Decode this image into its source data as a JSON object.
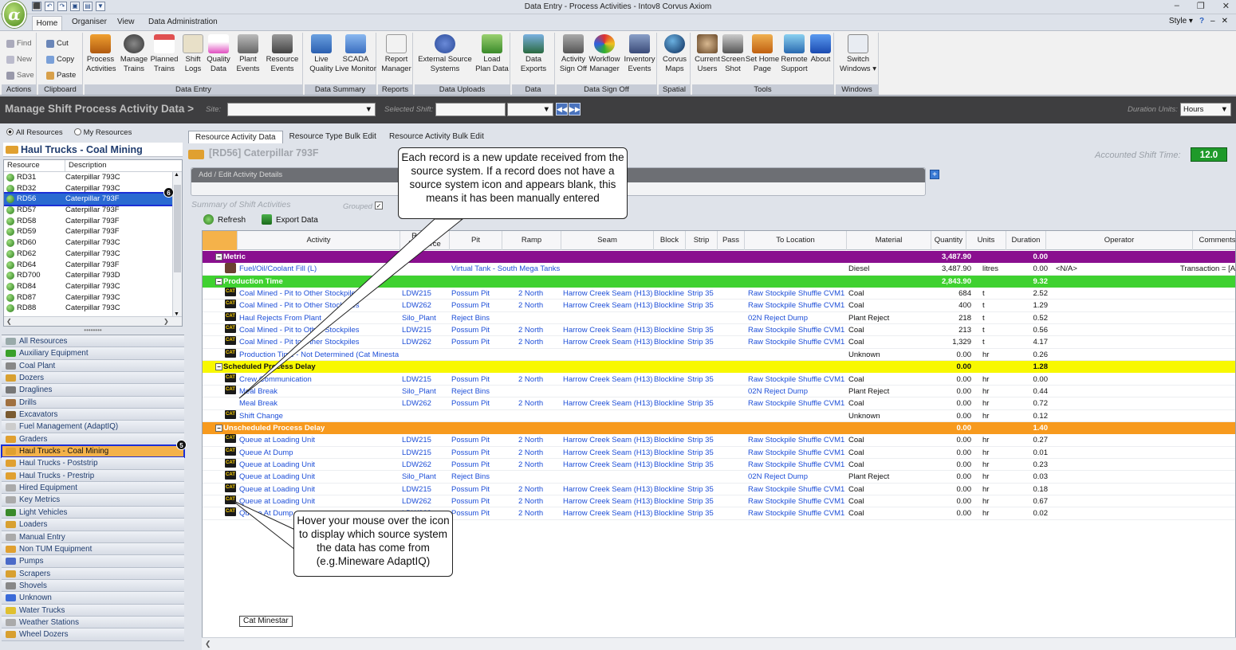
{
  "window": {
    "title": "Data Entry - Process Activities - Intov8 Corvus Axiom",
    "app_logo": "α",
    "controls": [
      "–",
      "❐",
      "✕"
    ],
    "qat_glyphs": [
      "⬛",
      "↶",
      "↷",
      "▣",
      "▤",
      "▼"
    ]
  },
  "ribbon_tabs": {
    "home": "Home",
    "organiser": "Organiser",
    "view": "View",
    "data_admin": "Data Administration"
  },
  "style_control": {
    "style": "Style ▾",
    "help": "?",
    "min": "–",
    "close": "✕"
  },
  "ribbon": {
    "actions": {
      "find": "Find",
      "new": "New",
      "save": "Save",
      "caption": "Actions"
    },
    "clipboard": {
      "cut": "Cut",
      "copy": "Copy",
      "paste": "Paste",
      "caption": "Clipboard"
    },
    "data_entry": {
      "process_activities": "Process\nActivities",
      "manage_trains": "Manage\nTrains",
      "planned_trains": "Planned\nTrains",
      "shift_logs": "Shift\nLogs",
      "quality_data": "Quality\nData",
      "plant_events": "Plant\nEvents",
      "resource_events": "Resource\nEvents",
      "caption": "Data Entry"
    },
    "data_summary": {
      "live_quality": "Live\nQuality",
      "scada": "SCADA\nLive Monitor",
      "caption": "Data Summary"
    },
    "reports": {
      "report_manager": "Report\nManager",
      "caption": "Reports"
    },
    "data_uploads": {
      "external_source": "External Source\nSystems",
      "load_plan": "Load\nPlan Data",
      "caption": "Data Uploads"
    },
    "data_exports": {
      "data_exports": "Data\nExports",
      "caption": "Data Exports"
    },
    "data_signoff": {
      "activity_signoff": "Activity\nSign Off",
      "workflow_manager": "Workflow\nManager",
      "inventory_events": "Inventory\nEvents",
      "caption": "Data Sign Off"
    },
    "spatial": {
      "corvus_maps": "Corvus\nMaps",
      "caption": "Spatial"
    },
    "tools": {
      "current_users": "Current\nUsers",
      "screen_shot": "Screen\nShot",
      "set_home": "Set Home\nPage",
      "remote_support": "Remote\nSupport",
      "about": "About",
      "caption": "Tools"
    },
    "windows": {
      "switch_windows": "Switch\nWindows ▾",
      "caption": "Windows"
    }
  },
  "header": {
    "title": "Manage Shift Process Activity Data  >",
    "site_label": "Site:",
    "site_value": "",
    "selected_shift_label": "Selected Shift:",
    "duration_units_label": "Duration Units:",
    "duration_units_value": "Hours",
    "dropdown_glyph": "▼",
    "nav_prev": "◀◀",
    "nav_next": "▶▶"
  },
  "left_panel": {
    "all_resources": "All Resources",
    "my_resources": "My Resources",
    "group_title": "Haul Trucks - Coal Mining",
    "col_resource": "Resource",
    "col_description": "Description",
    "scroll_up": "▲",
    "scroll_down": "▼",
    "scroll_left": "❮",
    "scroll_right": "❯",
    "splitter": "••••••••",
    "resources": [
      {
        "id": "RD31",
        "desc": "Caterpillar 793C"
      },
      {
        "id": "RD32",
        "desc": "Caterpillar 793C"
      },
      {
        "id": "RD56",
        "desc": "Caterpillar 793F"
      },
      {
        "id": "RD57",
        "desc": "Caterpillar 793F"
      },
      {
        "id": "RD58",
        "desc": "Caterpillar 793F"
      },
      {
        "id": "RD59",
        "desc": "Caterpillar 793F"
      },
      {
        "id": "RD60",
        "desc": "Caterpillar 793C"
      },
      {
        "id": "RD62",
        "desc": "Caterpillar 793C"
      },
      {
        "id": "RD64",
        "desc": "Caterpillar 793F"
      },
      {
        "id": "RD700",
        "desc": "Caterpillar 793D"
      },
      {
        "id": "RD84",
        "desc": "Caterpillar 793C"
      },
      {
        "id": "RD87",
        "desc": "Caterpillar 793C"
      },
      {
        "id": "RD88",
        "desc": "Caterpillar 793C"
      }
    ],
    "groups": [
      "All Resources",
      "Auxiliary Equipment",
      "Coal Plant",
      "Dozers",
      "Draglines",
      "Drills",
      "Excavators",
      "Fuel Management (AdaptIQ)",
      "Graders",
      "Haul Trucks - Coal Mining",
      "Haul Trucks - Poststrip",
      "Haul Trucks - Prestrip",
      "Hired Equipment",
      "Key Metrics",
      "Light Vehicles",
      "Loaders",
      "Manual Entry",
      "Non TUM Equipment",
      "Pumps",
      "Scrapers",
      "Shovels",
      "Unknown",
      "Water Trucks",
      "Weather Stations",
      "Wheel Dozers"
    ],
    "badge_resource": "6",
    "badge_group": "5"
  },
  "content_tabs": {
    "resource_activity": "Resource Activity Data",
    "type_bulk": "Resource Type Bulk Edit",
    "activity_bulk": "Resource Activity Bulk Edit"
  },
  "record": {
    "title": "[RD56] Caterpillar 793F",
    "accounted_label": "Accounted Shift Time:",
    "accounted_value": "12.0",
    "add_edit_label": "Add / Edit Activity Details",
    "add_glyph": "+",
    "summary_label": "Summary of Shift Activities",
    "grouped_label": "Grouped",
    "grouped_check": "✓",
    "refresh": "Refresh",
    "export": "Export Data"
  },
  "grid": {
    "columns": [
      "Activity",
      "Related\nResource",
      "Pit",
      "Ramp",
      "Seam",
      "Block",
      "Strip",
      "Pass",
      "To Location",
      "Material",
      "Quantity",
      "Units",
      "Duration",
      "Operator",
      "Comments"
    ],
    "groups": [
      {
        "name": "Metric",
        "quantity": "3,487.90",
        "duration": "0.00",
        "color": "#8a0f8f",
        "rows": [
          {
            "icon": "fuel",
            "activity": "Fuel/Oil/Coolant Fill (L)",
            "related": "",
            "pit": "Virtual Tank - South Mega Tanks",
            "ramp": "",
            "seam": "",
            "block": "",
            "strip": "",
            "to": "",
            "material": "Diesel",
            "qty": "3,487.90",
            "units": "litres",
            "dur": "0.00",
            "op": "<N/A>",
            "comment": "Transaction = [A"
          }
        ]
      },
      {
        "name": "Production Time",
        "quantity": "2,843.90",
        "duration": "9.32",
        "color": "#3fd130",
        "rows": [
          {
            "icon": "cat",
            "activity": "Coal Mined - Pit to Other Stockpiles",
            "related": "LDW215",
            "pit": "Possum Pit",
            "ramp": "2 North",
            "seam": "Harrow Creek Seam (H13)",
            "block": "Blockline",
            "strip": "Strip 35",
            "to": "Raw Stockpile Shuffle CVM1",
            "material": "Coal",
            "qty": "684",
            "units": "t",
            "dur": "2.52",
            "op": "",
            "comment": ""
          },
          {
            "icon": "cat",
            "activity": "Coal Mined - Pit to Other Stockpiles",
            "related": "LDW262",
            "pit": "Possum Pit",
            "ramp": "2 North",
            "seam": "Harrow Creek Seam (H13)",
            "block": "Blockline",
            "strip": "Strip 35",
            "to": "Raw Stockpile Shuffle CVM1",
            "material": "Coal",
            "qty": "400",
            "units": "t",
            "dur": "1.29",
            "op": "",
            "comment": ""
          },
          {
            "icon": "cat",
            "activity": "Haul Rejects From Plant",
            "related": "Silo_Plant",
            "pit": "Reject Bins",
            "ramp": "",
            "seam": "",
            "block": "",
            "strip": "",
            "to": "02N Reject Dump",
            "material": "Plant Reject",
            "qty": "218",
            "units": "t",
            "dur": "0.52",
            "op": "",
            "comment": ""
          },
          {
            "icon": "cat",
            "activity": "Coal Mined - Pit to Other Stockpiles",
            "related": "LDW215",
            "pit": "Possum Pit",
            "ramp": "2 North",
            "seam": "Harrow Creek Seam (H13)",
            "block": "Blockline",
            "strip": "Strip 35",
            "to": "Raw Stockpile Shuffle CVM1",
            "material": "Coal",
            "qty": "213",
            "units": "t",
            "dur": "0.56",
            "op": "",
            "comment": ""
          },
          {
            "icon": "cat",
            "activity": "Coal Mined - Pit to Other Stockpiles",
            "related": "LDW262",
            "pit": "Possum Pit",
            "ramp": "2 North",
            "seam": "Harrow Creek Seam (H13)",
            "block": "Blockline",
            "strip": "Strip 35",
            "to": "Raw Stockpile Shuffle CVM1",
            "material": "Coal",
            "qty": "1,329",
            "units": "t",
            "dur": "4.17",
            "op": "",
            "comment": ""
          },
          {
            "icon": "cat",
            "activity": "Production Time - Not Determined (Cat Minestar)",
            "related": "",
            "pit": "",
            "ramp": "",
            "seam": "",
            "block": "",
            "strip": "",
            "to": "",
            "material": "Unknown",
            "qty": "0.00",
            "units": "hr",
            "dur": "0.26",
            "op": "",
            "comment": ""
          }
        ]
      },
      {
        "name": "Scheduled Process Delay",
        "quantity": "0.00",
        "duration": "1.28",
        "color": "#f8f800",
        "rows": [
          {
            "icon": "cat",
            "activity": "Crew Communication",
            "related": "LDW215",
            "pit": "Possum Pit",
            "ramp": "2 North",
            "seam": "Harrow Creek Seam (H13)",
            "block": "Blockline",
            "strip": "Strip 35",
            "to": "Raw Stockpile Shuffle CVM1",
            "material": "Coal",
            "qty": "0.00",
            "units": "hr",
            "dur": "0.00",
            "op": "",
            "comment": ""
          },
          {
            "icon": "cat",
            "activity": "Meal Break",
            "related": "Silo_Plant",
            "pit": "Reject Bins",
            "ramp": "",
            "seam": "",
            "block": "",
            "strip": "",
            "to": "02N Reject Dump",
            "material": "Plant Reject",
            "qty": "0.00",
            "units": "hr",
            "dur": "0.44",
            "op": "",
            "comment": ""
          },
          {
            "icon": "",
            "activity": "Meal Break",
            "related": "LDW262",
            "pit": "Possum Pit",
            "ramp": "2 North",
            "seam": "Harrow Creek Seam (H13)",
            "block": "Blockline",
            "strip": "Strip 35",
            "to": "Raw Stockpile Shuffle CVM1",
            "material": "Coal",
            "qty": "0.00",
            "units": "hr",
            "dur": "0.72",
            "op": "",
            "comment": ""
          },
          {
            "icon": "cat",
            "activity": "Shift Change",
            "related": "",
            "pit": "",
            "ramp": "",
            "seam": "",
            "block": "",
            "strip": "",
            "to": "",
            "material": "Unknown",
            "qty": "0.00",
            "units": "hr",
            "dur": "0.12",
            "op": "",
            "comment": ""
          }
        ]
      },
      {
        "name": "Unscheduled Process Delay",
        "quantity": "0.00",
        "duration": "1.40",
        "color": "#f79a1e",
        "rows": [
          {
            "icon": "cat",
            "activity": "Queue at Loading Unit",
            "related": "LDW215",
            "pit": "Possum Pit",
            "ramp": "2 North",
            "seam": "Harrow Creek Seam (H13)",
            "block": "Blockline",
            "strip": "Strip 35",
            "to": "Raw Stockpile Shuffle CVM1",
            "material": "Coal",
            "qty": "0.00",
            "units": "hr",
            "dur": "0.27",
            "op": "",
            "comment": ""
          },
          {
            "icon": "cat",
            "activity": "Queue At Dump",
            "related": "LDW215",
            "pit": "Possum Pit",
            "ramp": "2 North",
            "seam": "Harrow Creek Seam (H13)",
            "block": "Blockline",
            "strip": "Strip 35",
            "to": "Raw Stockpile Shuffle CVM1",
            "material": "Coal",
            "qty": "0.00",
            "units": "hr",
            "dur": "0.01",
            "op": "",
            "comment": ""
          },
          {
            "icon": "cat",
            "activity": "Queue at Loading Unit",
            "related": "LDW262",
            "pit": "Possum Pit",
            "ramp": "2 North",
            "seam": "Harrow Creek Seam (H13)",
            "block": "Blockline",
            "strip": "Strip 35",
            "to": "Raw Stockpile Shuffle CVM1",
            "material": "Coal",
            "qty": "0.00",
            "units": "hr",
            "dur": "0.23",
            "op": "",
            "comment": ""
          },
          {
            "icon": "cat",
            "activity": "Queue at Loading Unit",
            "related": "Silo_Plant",
            "pit": "Reject Bins",
            "ramp": "",
            "seam": "",
            "block": "",
            "strip": "",
            "to": "02N Reject Dump",
            "material": "Plant Reject",
            "qty": "0.00",
            "units": "hr",
            "dur": "0.03",
            "op": "",
            "comment": ""
          },
          {
            "icon": "cat",
            "activity": "Queue at Loading Unit",
            "related": "LDW215",
            "pit": "Possum Pit",
            "ramp": "2 North",
            "seam": "Harrow Creek Seam (H13)",
            "block": "Blockline",
            "strip": "Strip 35",
            "to": "Raw Stockpile Shuffle CVM1",
            "material": "Coal",
            "qty": "0.00",
            "units": "hr",
            "dur": "0.18",
            "op": "",
            "comment": ""
          },
          {
            "icon": "cat",
            "activity": "Queue at Loading Unit",
            "related": "LDW262",
            "pit": "Possum Pit",
            "ramp": "2 North",
            "seam": "Harrow Creek Seam (H13)",
            "block": "Blockline",
            "strip": "Strip 35",
            "to": "Raw Stockpile Shuffle CVM1",
            "material": "Coal",
            "qty": "0.00",
            "units": "hr",
            "dur": "0.67",
            "op": "",
            "comment": ""
          },
          {
            "icon": "cat",
            "activity": "Queue At Dump",
            "related": "LDW262",
            "pit": "Possum Pit",
            "ramp": "2 North",
            "seam": "Harrow Creek Seam (H13)",
            "block": "Blockline",
            "strip": "Strip 35",
            "to": "Raw Stockpile Shuffle CVM1",
            "material": "Coal",
            "qty": "0.00",
            "units": "hr",
            "dur": "0.02",
            "op": "",
            "comment": ""
          }
        ]
      }
    ],
    "cat_label": "CAT",
    "expand_glyph": "−",
    "tooltip": "Cat Minestar",
    "hscroll": "❮"
  },
  "callouts": {
    "record_note": "Each record is a new update received from the source system. If a record does not have a source system icon and appears blank, this means it has been manually entered",
    "hover_note": "Hover your mouse over the icon to display which source system the data has come from (e.g.Mineware AdaptIQ)"
  }
}
